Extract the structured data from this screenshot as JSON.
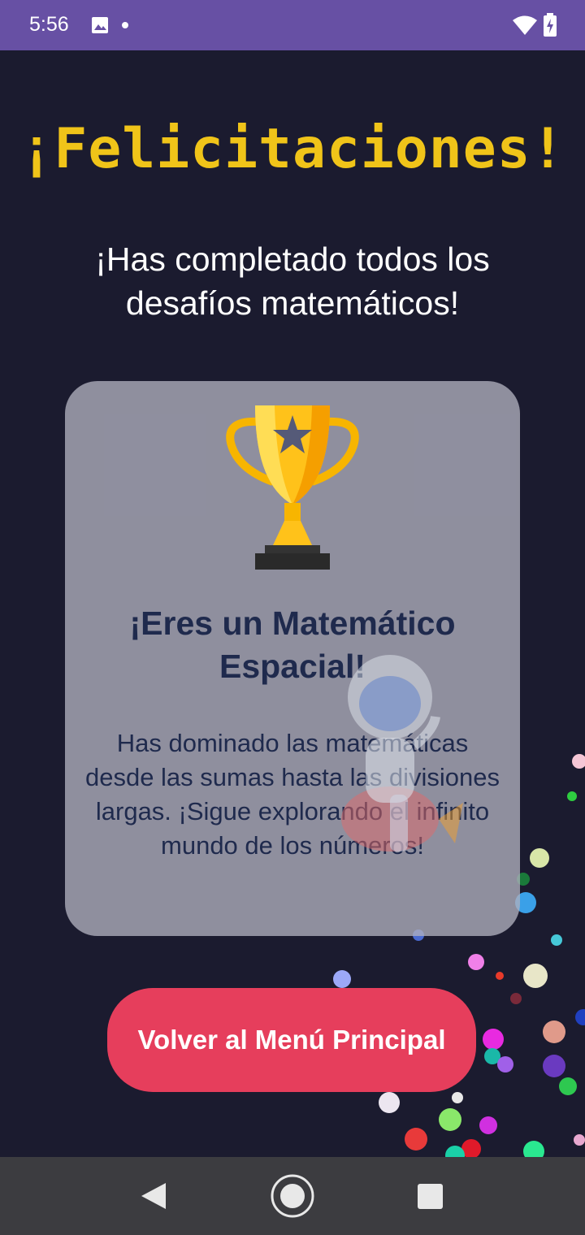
{
  "status_bar": {
    "time": "5:56",
    "icons": [
      "image-icon",
      "dot-icon",
      "wifi-icon",
      "battery-charging-icon"
    ]
  },
  "app": {
    "title": "¡Felicitaciones!",
    "subtitle": "¡Has completado todos los desafíos matemáticos!",
    "card": {
      "icon": "trophy-icon",
      "heading": "¡Eres un Matemático Espacial!",
      "message": "Has dominado las matemáticas desde las sumas hasta las divisiones largas. ¡Sigue explorando el infinito mundo de los números!",
      "decoration_icon": "astronaut-rocket-icon"
    },
    "menu_button_label": "Volver al Menú Principal"
  },
  "nav_bar": {
    "icons": [
      "back-icon",
      "home-icon",
      "recents-icon"
    ]
  },
  "colors": {
    "status_bar": "#6750a4",
    "background": "#1b1b2f",
    "title": "#f0c419",
    "card_text": "#1f2a4d",
    "button": "#e63e5c",
    "nav_bar": "#3c3c40"
  }
}
